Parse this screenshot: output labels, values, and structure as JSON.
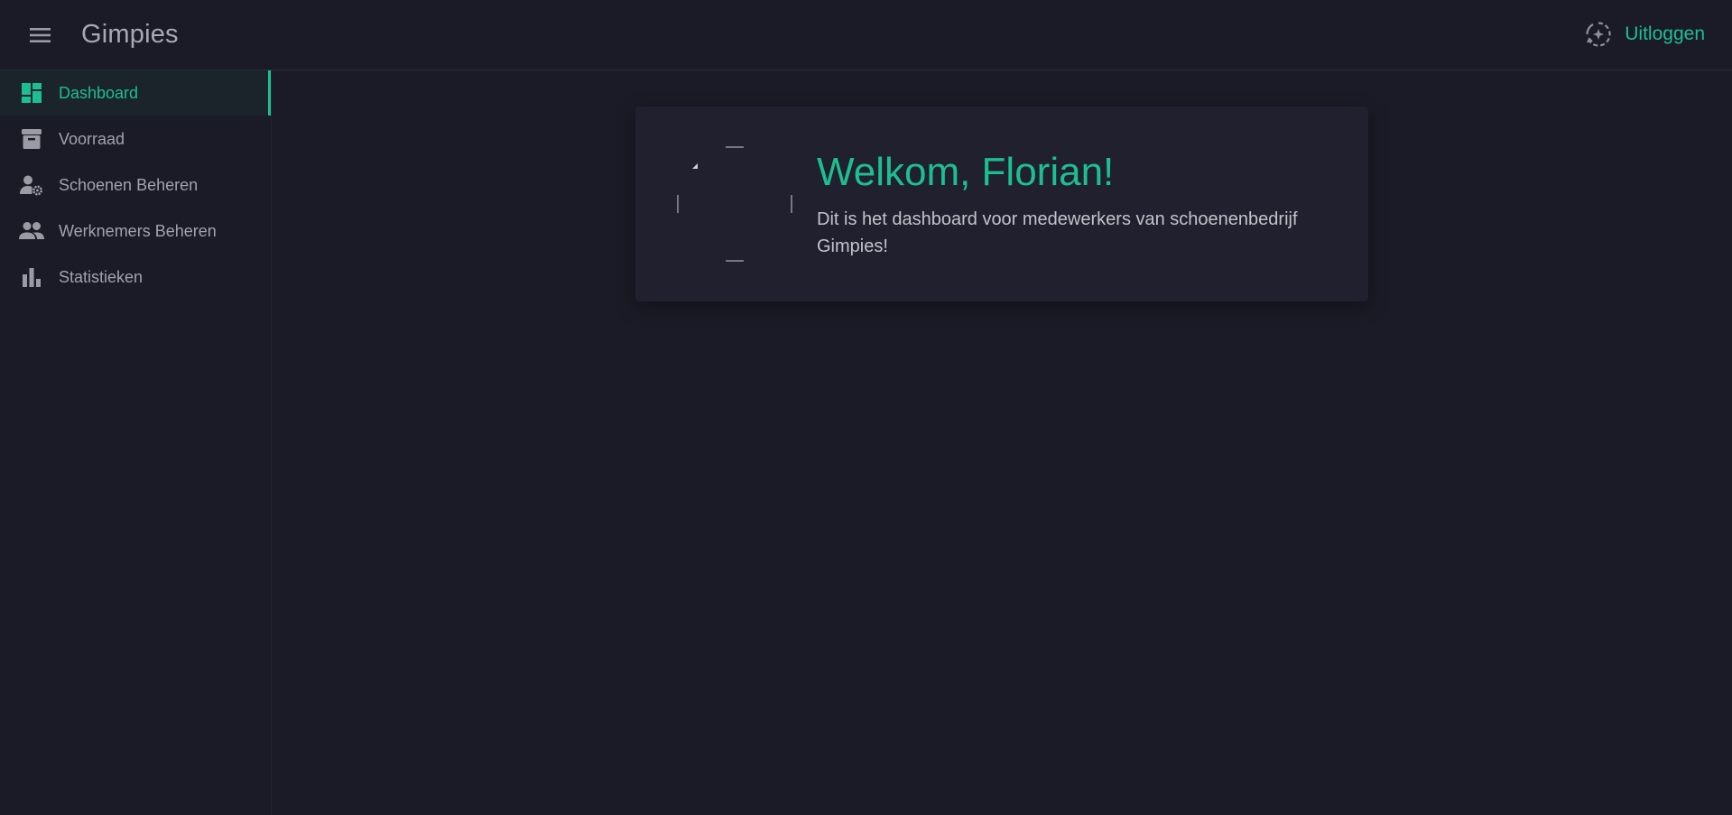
{
  "header": {
    "app_title": "Gimpies",
    "logout_label": "Uitloggen",
    "menu_icon": "hamburger-menu-icon",
    "logout_icon": "logout-sparkle-icon"
  },
  "sidebar": {
    "items": [
      {
        "label": "Dashboard",
        "icon": "dashboard-icon",
        "active": true
      },
      {
        "label": "Voorraad",
        "icon": "archive-box-icon",
        "active": false
      },
      {
        "label": "Schoenen Beheren",
        "icon": "user-gear-icon",
        "active": false
      },
      {
        "label": "Werknemers Beheren",
        "icon": "people-icon",
        "active": false
      },
      {
        "label": "Statistieken",
        "icon": "bar-chart-icon",
        "active": false
      }
    ]
  },
  "card": {
    "title": "Welkom, Florian!",
    "text": "Dit is het dashboard voor medewerkers van schoenenbedrijf Gimpies!"
  },
  "colors": {
    "accent": "#1dbf91",
    "background": "#1b1b27",
    "card": "#20202e",
    "muted_text": "#a2a2ad"
  }
}
